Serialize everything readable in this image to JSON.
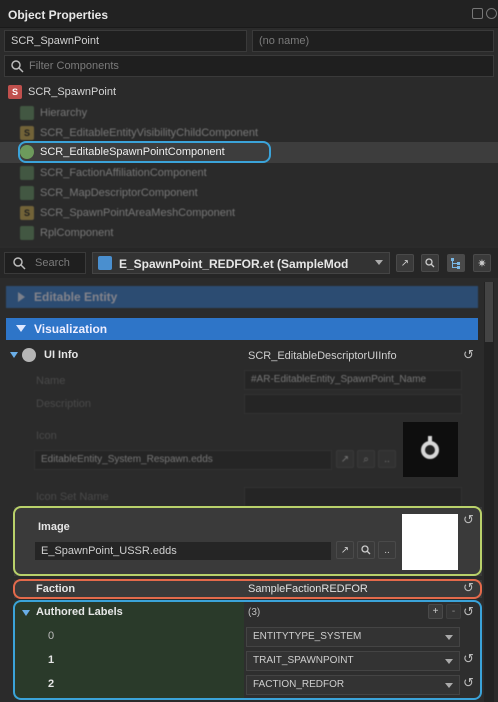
{
  "panel": {
    "title": "Object Properties"
  },
  "entity": {
    "name": "SCR_SpawnPoint",
    "name2_placeholder": "(no name)"
  },
  "filter": {
    "placeholder": "Filter Components"
  },
  "components": {
    "root": "SCR_SpawnPoint",
    "items": [
      "Hierarchy",
      "SCR_EditableEntityVisibilityChildComponent",
      "SCR_EditableSpawnPointComponent",
      "SCR_FactionAffiliationComponent",
      "SCR_MapDescriptorComponent",
      "SCR_SpawnPointAreaMeshComponent",
      "RplComponent"
    ]
  },
  "toolbar": {
    "search_placeholder": "Search",
    "prefab": "E_SpawnPoint_REDFOR.et (SampleMod"
  },
  "sections": {
    "editable_entity": "Editable Entity",
    "visualization": "Visualization"
  },
  "ui_info": {
    "label": "UI Info",
    "value": "SCR_EditableDescriptorUIInfo",
    "name_label": "Name",
    "name_value": "#AR-EditableEntity_SpawnPoint_Name",
    "description_label": "Description",
    "icon_label": "Icon",
    "icon_value": "EditableEntity_System_Respawn.edds",
    "icon_set_label": "Icon Set Name",
    "image_label": "Image",
    "image_value": "E_SpawnPoint_USSR.edds"
  },
  "faction": {
    "label": "Faction",
    "value": "SampleFactionREDFOR"
  },
  "authored_labels": {
    "label": "Authored Labels",
    "count": "(3)",
    "rows": [
      {
        "index": "0",
        "value": "ENTITYTYPE_SYSTEM"
      },
      {
        "index": "1",
        "value": "TRAIT_SPAWNPOINT"
      },
      {
        "index": "2",
        "value": "FACTION_REDFOR"
      }
    ]
  },
  "glyphs": {
    "reset": "↺",
    "more": "..",
    "plus": "+",
    "minus": "-"
  },
  "colors": {
    "accent": "#2e75c8",
    "highlight_blue": "#3ba3d9",
    "highlight_green": "#b9d16a",
    "highlight_red": "#e46a4b"
  }
}
